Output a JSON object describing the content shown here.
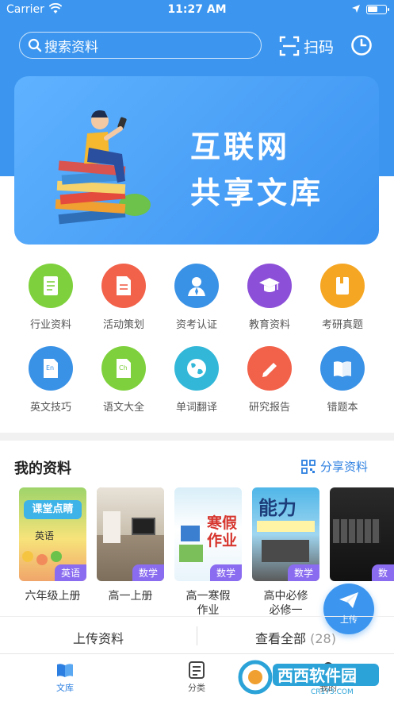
{
  "status_bar": {
    "carrier": "Carrier",
    "time": "11:27 AM"
  },
  "header": {
    "search_placeholder": "搜索资料",
    "scan_label": "扫码",
    "history_icon": "clock-icon"
  },
  "banner": {
    "line1": "互联网",
    "line2": "共享文库"
  },
  "categories": [
    {
      "label": "行业资料",
      "icon": "document-icon",
      "color": "#7ed13c"
    },
    {
      "label": "活动策划",
      "icon": "document-icon",
      "color": "#f2614a"
    },
    {
      "label": "资考认证",
      "icon": "person-icon",
      "color": "#3a92e6"
    },
    {
      "label": "教育资料",
      "icon": "graduation-cap-icon",
      "color": "#8c4fd8"
    },
    {
      "label": "考研真题",
      "icon": "notebook-icon",
      "color": "#f5a623"
    },
    {
      "label": "英文技巧",
      "icon": "english-doc-icon",
      "color": "#3a92e6"
    },
    {
      "label": "语文大全",
      "icon": "chinese-doc-icon",
      "color": "#7ed13c"
    },
    {
      "label": "单词翻译",
      "icon": "globe-icon",
      "color": "#32b7d8"
    },
    {
      "label": "研究报告",
      "icon": "pencil-icon",
      "color": "#f2614a"
    },
    {
      "label": "错题本",
      "icon": "book-icon",
      "color": "#3a92e6"
    }
  ],
  "my_materials": {
    "title": "我的资料",
    "share_label": "分享资料",
    "books": [
      {
        "name": "六年级上册",
        "tag": "英语",
        "cover_text": "课堂点睛",
        "cover_sub": "英语"
      },
      {
        "name": "高一上册",
        "tag": "数学"
      },
      {
        "name": "高一寒假作业",
        "tag": "数学",
        "cover_text": "寒假作业"
      },
      {
        "name": "高中必修必修一",
        "tag": "数学",
        "cover_text": "能力"
      },
      {
        "name": "",
        "tag": "数"
      }
    ]
  },
  "fab": {
    "label": "上传"
  },
  "actions": {
    "upload": "上传资料",
    "view_all": "查看全部",
    "count": "(28)"
  },
  "tabbar": [
    {
      "label": "文库",
      "active": true
    },
    {
      "label": "分类",
      "active": false
    },
    {
      "label": "我的",
      "active": false
    }
  ],
  "watermark": {
    "text": "西西软件园",
    "sub": "CR173.COM"
  },
  "colors": {
    "primary": "#3c96ef",
    "tag_purple": "#8a6cf0"
  }
}
